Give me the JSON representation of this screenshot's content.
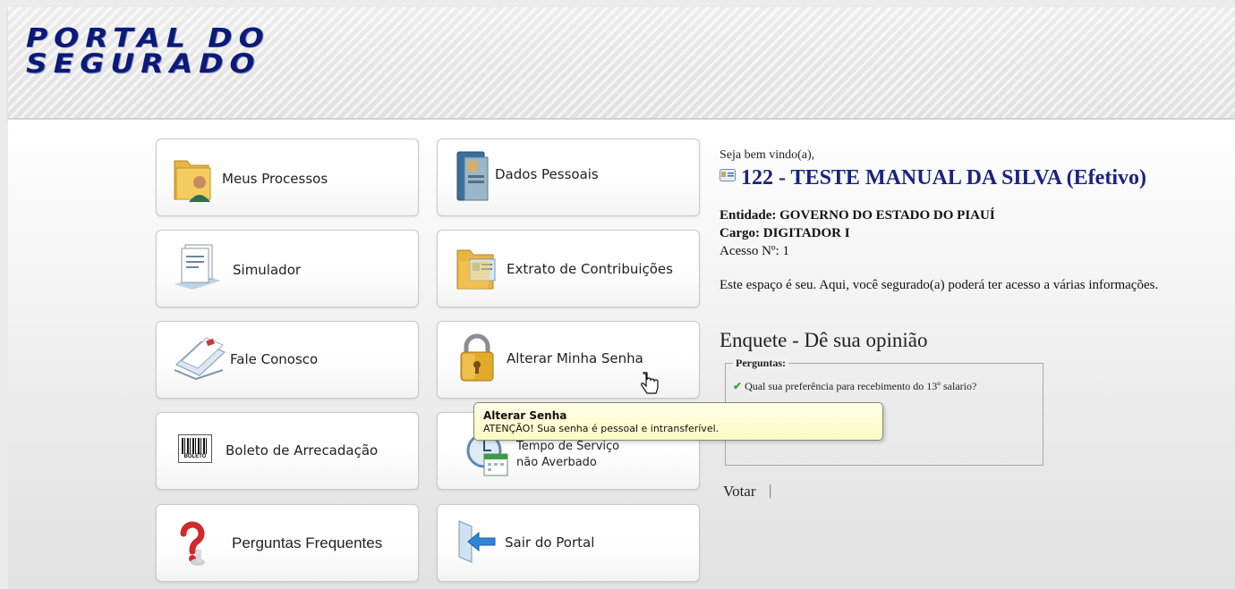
{
  "header": {
    "logo_line1": "PORTAL DO",
    "logo_line2": "SEGURADO"
  },
  "menu": {
    "meus_processos": "Meus Processos",
    "dados_pessoais": "Dados Pessoais",
    "simulador": "Simulador",
    "extrato": "Extrato de Contribuições",
    "fale_conosco": "Fale Conosco",
    "alterar_senha": "Alterar Minha Senha",
    "boleto": "Boleto de Arrecadação",
    "tempo_servico_1": "Tempo de Serviço",
    "tempo_servico_2": "não Averbado",
    "perguntas": "Perguntas Frequentes",
    "sair": "Sair do Portal",
    "boleto_icon_text": "BOLETO"
  },
  "user": {
    "welcome": "Seja bem vindo(a),",
    "name": "122 - TESTE MANUAL DA SILVA (Efetivo)",
    "entidade_label": "Entidade:",
    "entidade_value": "GOVERNO DO ESTADO DO PIAUÍ",
    "cargo_label": "Cargo:",
    "cargo_value": "DIGITADOR I",
    "acesso": "Acesso Nº: 1",
    "description": "Este espaço é seu. Aqui, você segurado(a) poderá ter acesso a várias informações."
  },
  "poll": {
    "title": "Enquete - Dê sua opinião",
    "legend": "Perguntas:",
    "question": "Qual sua preferência para recebimento do 13º salario?",
    "vote_label": "Votar",
    "separator": "|"
  },
  "tooltip": {
    "title": "Alterar Senha",
    "text": "ATENÇÃO! Sua senha é pessoal e intransferível."
  },
  "colors": {
    "brand_blue": "#0b1a77",
    "name_blue": "#1a2280",
    "tooltip_bg": "#fbfbc4"
  }
}
